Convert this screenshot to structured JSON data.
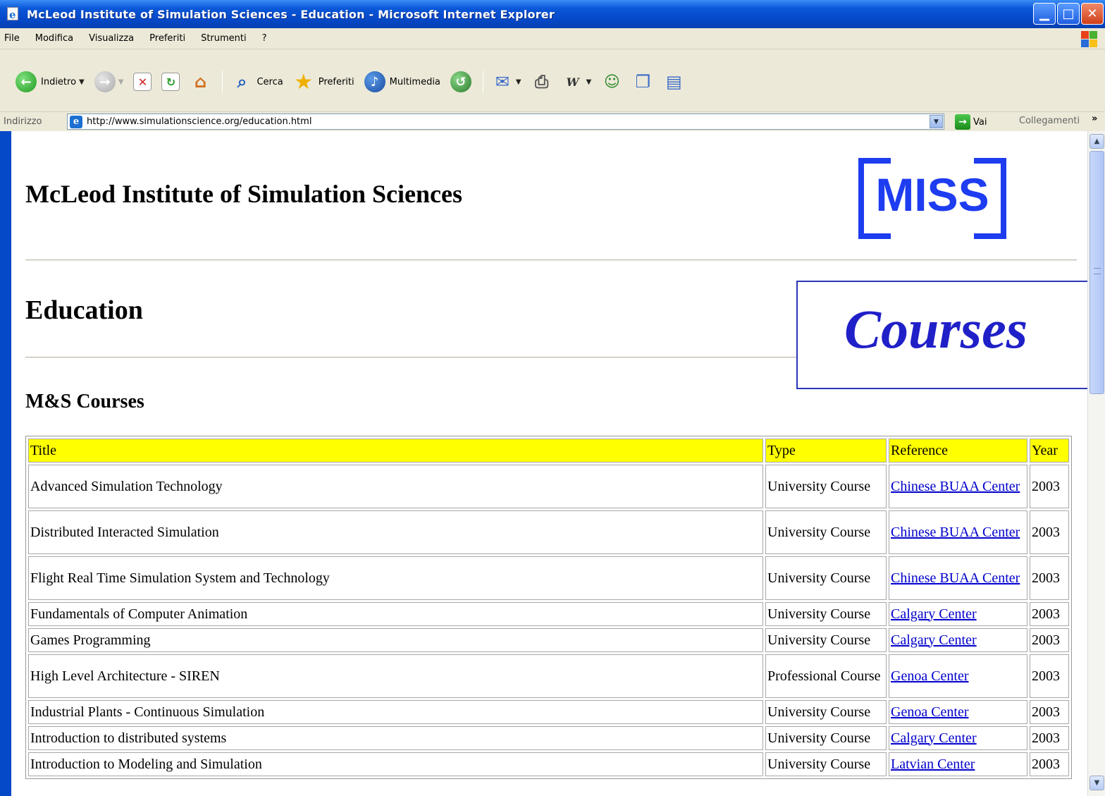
{
  "window": {
    "title": "McLeod Institute of Simulation Sciences - Education - Microsoft Internet Explorer"
  },
  "menu": {
    "items": [
      "File",
      "Modifica",
      "Visualizza",
      "Preferiti",
      "Strumenti",
      "?"
    ]
  },
  "toolbar": {
    "back_label": "Indietro",
    "search_label": "Cerca",
    "favorites_label": "Preferiti",
    "media_label": "Multimedia"
  },
  "address_bar": {
    "label": "Indirizzo",
    "url": "http://www.simulationscience.org/education.html",
    "go_label": "Vai",
    "links_label": "Collegamenti"
  },
  "page": {
    "site_title": "McLeod Institute of Simulation Sciences",
    "logo_text": "MISS",
    "section_title": "Education",
    "overlay_label": "Courses",
    "subsection_title": "M&S Courses",
    "link_color": "#0000cc",
    "header_bg": "#ffff00",
    "table": {
      "headers": [
        "Title",
        "Type",
        "Reference",
        "Year"
      ],
      "rows": [
        {
          "title": "Advanced Simulation Technology",
          "type": "University Course",
          "reference": "Chinese BUAA Center",
          "year": "2003"
        },
        {
          "title": "Distributed Interacted Simulation",
          "type": "University Course",
          "reference": "Chinese BUAA Center",
          "year": "2003"
        },
        {
          "title": "Flight Real Time Simulation System and Technology",
          "type": "University Course",
          "reference": "Chinese BUAA Center",
          "year": "2003"
        },
        {
          "title": "Fundamentals of Computer Animation",
          "type": "University Course",
          "reference": "Calgary Center",
          "year": "2003"
        },
        {
          "title": "Games Programming",
          "type": "University Course",
          "reference": "Calgary Center",
          "year": "2003"
        },
        {
          "title": "High Level Architecture - SIREN",
          "type": "Professional Course",
          "reference": "Genoa Center",
          "year": "2003"
        },
        {
          "title": "Industrial Plants - Continuous Simulation",
          "type": "University Course",
          "reference": "Genoa Center",
          "year": "2003"
        },
        {
          "title": "Introduction to distributed systems",
          "type": "University Course",
          "reference": "Calgary Center",
          "year": "2003"
        },
        {
          "title": "Introduction to Modeling and Simulation",
          "type": "University Course",
          "reference": "Latvian Center",
          "year": "2003"
        }
      ]
    }
  }
}
